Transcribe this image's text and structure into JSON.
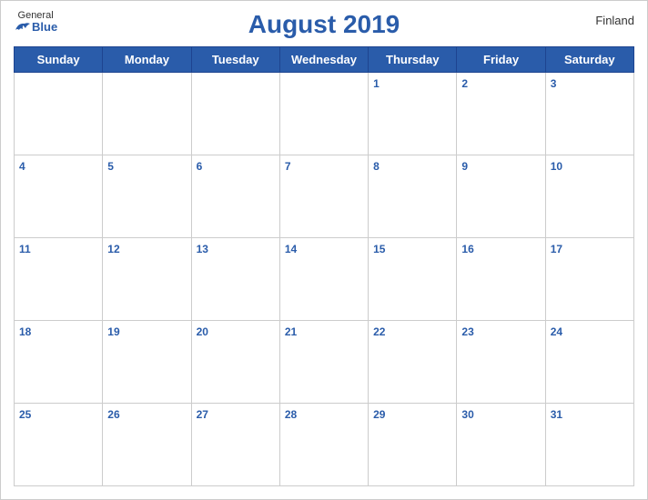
{
  "header": {
    "logo_general": "General",
    "logo_blue": "Blue",
    "title": "August 2019",
    "country": "Finland"
  },
  "weekdays": [
    "Sunday",
    "Monday",
    "Tuesday",
    "Wednesday",
    "Thursday",
    "Friday",
    "Saturday"
  ],
  "weeks": [
    [
      null,
      null,
      null,
      null,
      1,
      2,
      3
    ],
    [
      4,
      5,
      6,
      7,
      8,
      9,
      10
    ],
    [
      11,
      12,
      13,
      14,
      15,
      16,
      17
    ],
    [
      18,
      19,
      20,
      21,
      22,
      23,
      24
    ],
    [
      25,
      26,
      27,
      28,
      29,
      30,
      31
    ]
  ]
}
